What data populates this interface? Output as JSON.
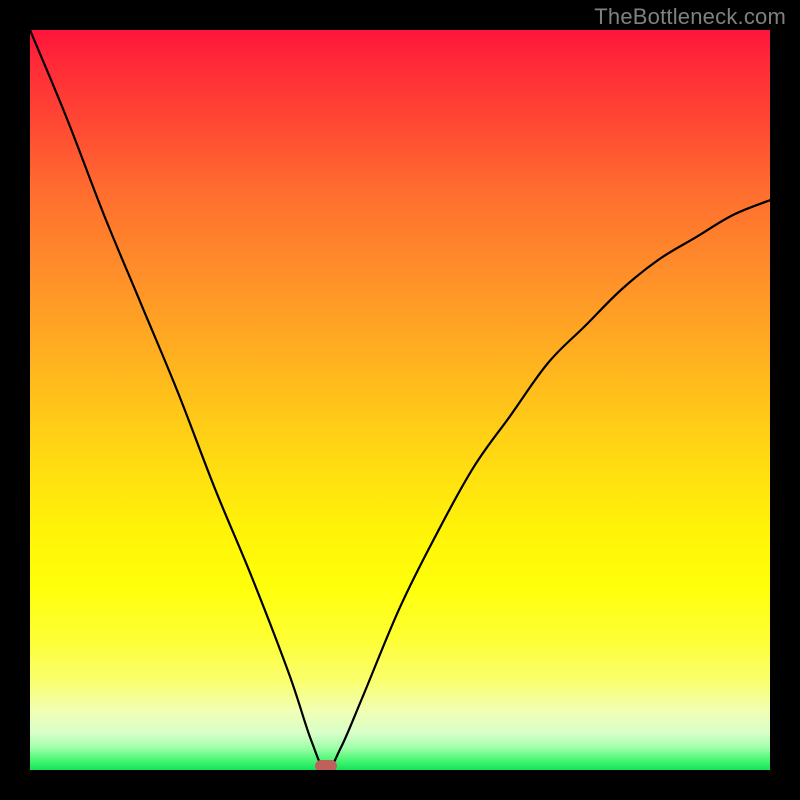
{
  "watermark": "TheBottleneck.com",
  "colors": {
    "frame": "#000000",
    "curve": "#000000",
    "marker": "#c0605a",
    "watermark_text": "#808080"
  },
  "chart_data": {
    "type": "line",
    "title": "",
    "xlabel": "",
    "ylabel": "",
    "xlim": [
      0,
      100
    ],
    "ylim": [
      0,
      100
    ],
    "grid": false,
    "legend": false,
    "x": [
      0,
      5,
      10,
      15,
      20,
      25,
      30,
      35,
      38,
      40,
      42,
      45,
      50,
      55,
      60,
      65,
      70,
      75,
      80,
      85,
      90,
      95,
      100
    ],
    "series": [
      {
        "name": "bottleneck_curve",
        "values": [
          100,
          88,
          75,
          63,
          51,
          38,
          26,
          13,
          4,
          0,
          3,
          10,
          22,
          32,
          41,
          48,
          55,
          60,
          65,
          69,
          72,
          75,
          77
        ]
      }
    ],
    "marker": {
      "x": 40,
      "y": 0
    }
  }
}
